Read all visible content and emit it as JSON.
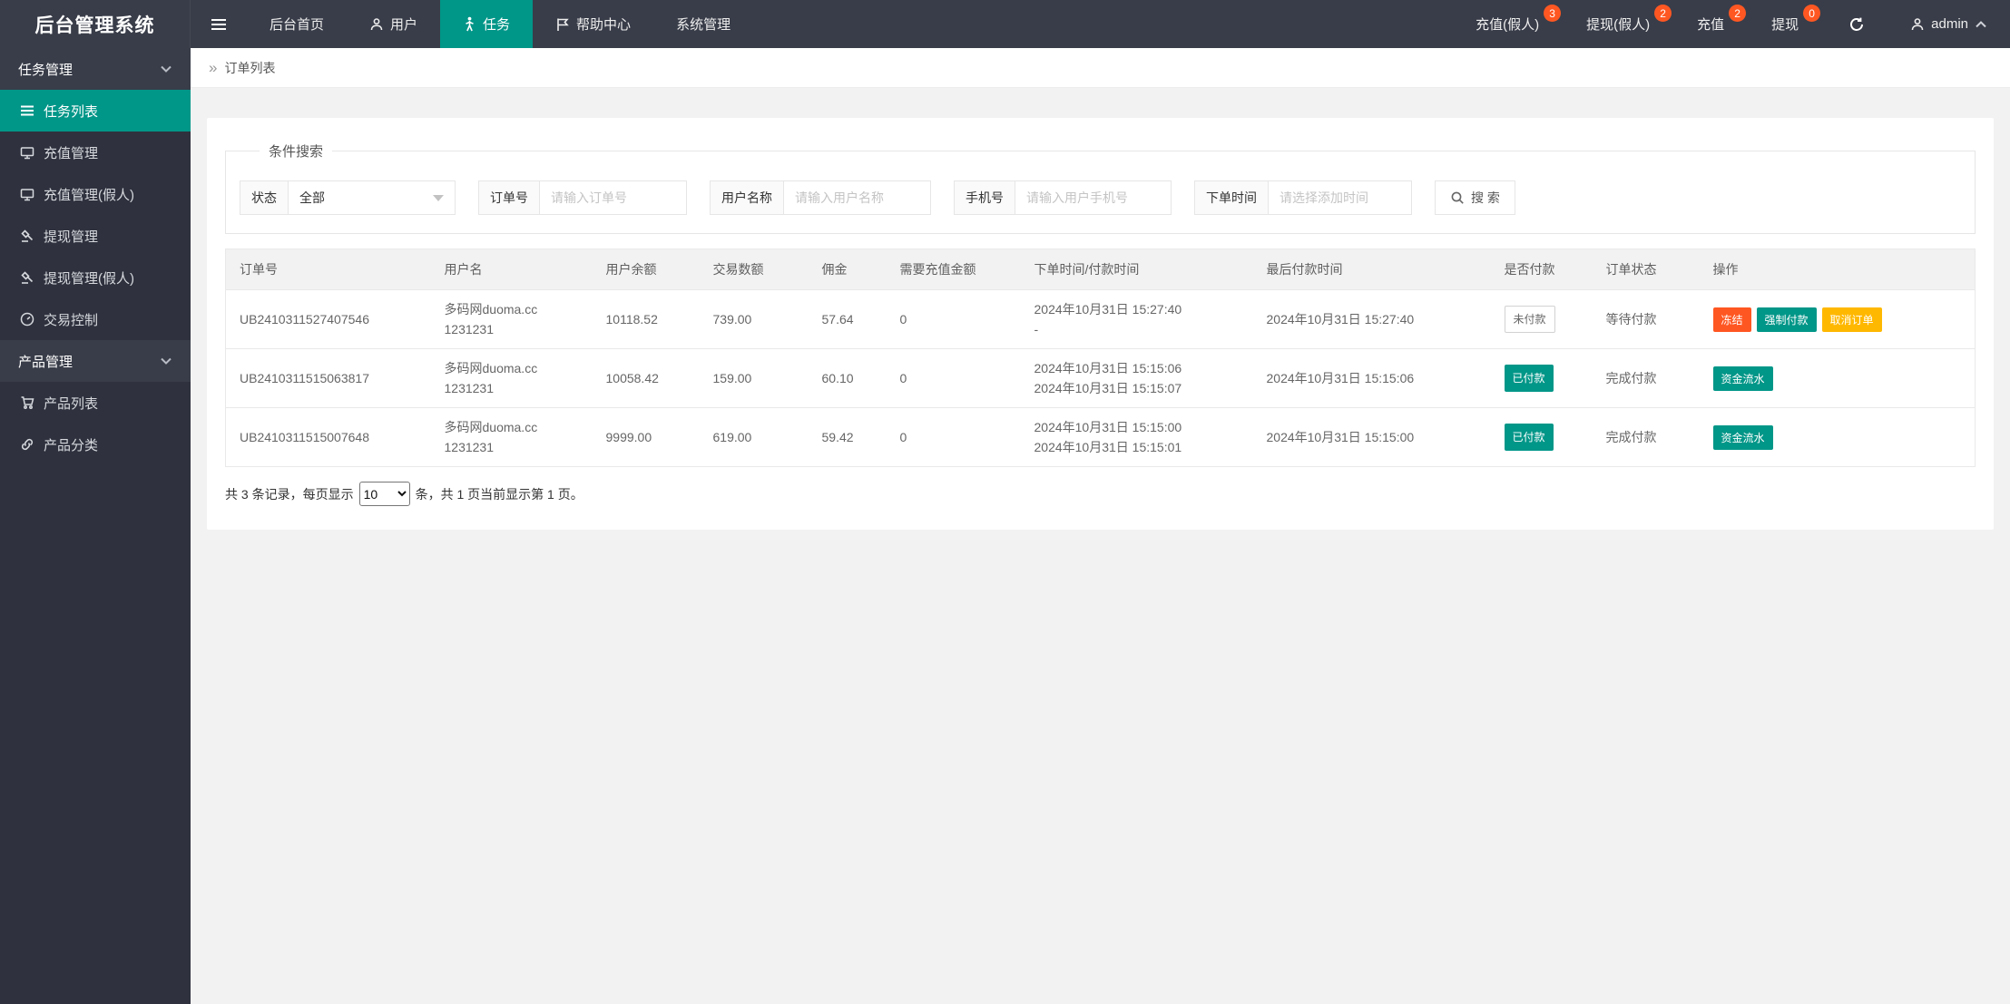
{
  "colors": {
    "accent": "#009688",
    "danger": "#FF5722",
    "warning": "#FFB800",
    "badge": "#FF5722",
    "navbar": "#393D49",
    "sidebar": "#2F323E"
  },
  "app": {
    "title": "后台管理系统"
  },
  "topnav": {
    "items": [
      {
        "label": "后台首页"
      },
      {
        "label": "用户"
      },
      {
        "label": "任务"
      },
      {
        "label": "帮助中心"
      },
      {
        "label": "系统管理"
      }
    ],
    "right_items": [
      {
        "label": "充值(假人)",
        "badge": "3"
      },
      {
        "label": "提现(假人)",
        "badge": "2"
      },
      {
        "label": "充值",
        "badge": "2"
      },
      {
        "label": "提现",
        "badge": "0"
      }
    ],
    "username": "admin"
  },
  "sidebar": {
    "groups": [
      {
        "label": "任务管理",
        "items": [
          {
            "label": "任务列表"
          },
          {
            "label": "充值管理"
          },
          {
            "label": "充值管理(假人)"
          },
          {
            "label": "提现管理"
          },
          {
            "label": "提现管理(假人)"
          },
          {
            "label": "交易控制"
          }
        ]
      },
      {
        "label": "产品管理",
        "items": [
          {
            "label": "产品列表"
          },
          {
            "label": "产品分类"
          }
        ]
      }
    ]
  },
  "breadcrumb": {
    "icon": "»",
    "current": "订单列表"
  },
  "search_form": {
    "legend": "条件搜索",
    "status": {
      "label": "状态",
      "value": "全部"
    },
    "order_no": {
      "label": "订单号",
      "placeholder": "请输入订单号"
    },
    "user_name": {
      "label": "用户名称",
      "placeholder": "请输入用户名称"
    },
    "phone": {
      "label": "手机号",
      "placeholder": "请输入用户手机号"
    },
    "order_time": {
      "label": "下单时间",
      "placeholder": "请选择添加时间"
    },
    "search_label": "搜 索"
  },
  "table": {
    "columns": [
      "订单号",
      "用户名",
      "用户余额",
      "交易数额",
      "佣金",
      "需要充值金额",
      "下单时间/付款时间",
      "最后付款时间",
      "是否付款",
      "订单状态",
      "操作"
    ],
    "rows": [
      {
        "order_no": "UB2410311527407546",
        "user_site": "多码网duoma.cc",
        "user_account": "1231231",
        "balance": "10118.52",
        "trade_amount": "739.00",
        "commission": "57.64",
        "need_recharge": "0",
        "order_time": "2024年10月31日 15:27:40",
        "pay_time": "-",
        "last_pay_time": "2024年10月31日 15:27:40",
        "paid_label": "未付款",
        "status": "等待付款",
        "actions": [
          {
            "label": "冻结"
          },
          {
            "label": "强制付款"
          },
          {
            "label": "取消订单"
          }
        ]
      },
      {
        "order_no": "UB2410311515063817",
        "user_site": "多码网duoma.cc",
        "user_account": "1231231",
        "balance": "10058.42",
        "trade_amount": "159.00",
        "commission": "60.10",
        "need_recharge": "0",
        "order_time": "2024年10月31日 15:15:06",
        "pay_time": "2024年10月31日 15:15:07",
        "last_pay_time": "2024年10月31日 15:15:06",
        "paid_label": "已付款",
        "status": "完成付款",
        "actions": [
          {
            "label": "资金流水"
          }
        ]
      },
      {
        "order_no": "UB2410311515007648",
        "user_site": "多码网duoma.cc",
        "user_account": "1231231",
        "balance": "9999.00",
        "trade_amount": "619.00",
        "commission": "59.42",
        "need_recharge": "0",
        "order_time": "2024年10月31日 15:15:00",
        "pay_time": "2024年10月31日 15:15:01",
        "last_pay_time": "2024年10月31日 15:15:00",
        "paid_label": "已付款",
        "status": "完成付款",
        "actions": [
          {
            "label": "资金流水"
          }
        ]
      }
    ]
  },
  "pagination": {
    "prefix": "共 3 条记录，每页显示",
    "page_size": "10",
    "suffix": "条，共 1 页当前显示第 1 页。"
  }
}
